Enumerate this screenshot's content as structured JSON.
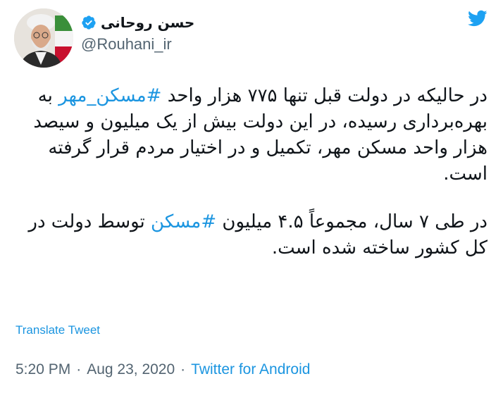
{
  "icons": {
    "brand": "twitter-bird-icon",
    "verified": "verified-badge-icon"
  },
  "colors": {
    "brand_blue": "#1da1f2",
    "link_blue": "#1b95e0",
    "text": "#0f1419",
    "muted": "#536471"
  },
  "author": {
    "name": "حسن روحانی",
    "handle": "@Rouhani_ir",
    "verified": true
  },
  "tweet": {
    "p1": {
      "a": "در حالیکه در دولت قبل تنها ۷۷۵ هزار واحد ",
      "hashtag": "#مسکن_مهر",
      "b": " به بهره‌برداری رسیده، در این دولت بیش از یک میلیون و سیصد هزار واحد مسکن مهر، تکمیل و در اختیار مردم قرار گرفته است."
    },
    "p2": {
      "a": "در طی ۷ سال، مجموعاً ۴.۵ میلیون ",
      "hashtag": "#مسکن",
      "b": " توسط دولت در کل کشور ساخته شده است."
    },
    "translate_label": "Translate Tweet"
  },
  "meta": {
    "time": "5:20 PM",
    "sep1": "·",
    "date": "Aug 23, 2020",
    "sep2": "·",
    "source": "Twitter for Android"
  }
}
